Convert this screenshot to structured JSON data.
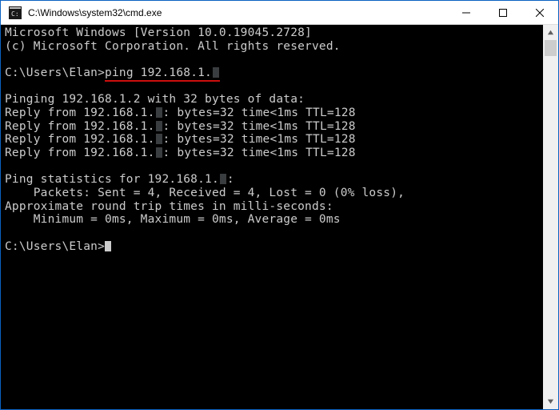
{
  "titlebar": {
    "title": "C:\\Windows\\system32\\cmd.exe"
  },
  "term": {
    "banner1": "Microsoft Windows [Version 10.0.19045.2728]",
    "banner2": "(c) Microsoft Corporation. All rights reserved.",
    "prompt1_prefix": "C:\\Users\\Elan>",
    "cmd_full": "ping 192.168.1.",
    "blank": "",
    "pinging": "Pinging 192.168.1.2 with 32 bytes of data:",
    "reply_prefix": "Reply from 192.168.1.",
    "reply_suffix": ": bytes=32 time<1ms TTL=128",
    "stats_hdr_prefix": "Ping statistics for 192.168.1.",
    "stats_hdr_suffix": ":",
    "packets": "    Packets: Sent = 4, Received = 4, Lost = 0 (0% loss),",
    "rtt_hdr": "Approximate round trip times in milli-seconds:",
    "rtt": "    Minimum = 0ms, Maximum = 0ms, Average = 0ms",
    "prompt2": "C:\\Users\\Elan>"
  }
}
